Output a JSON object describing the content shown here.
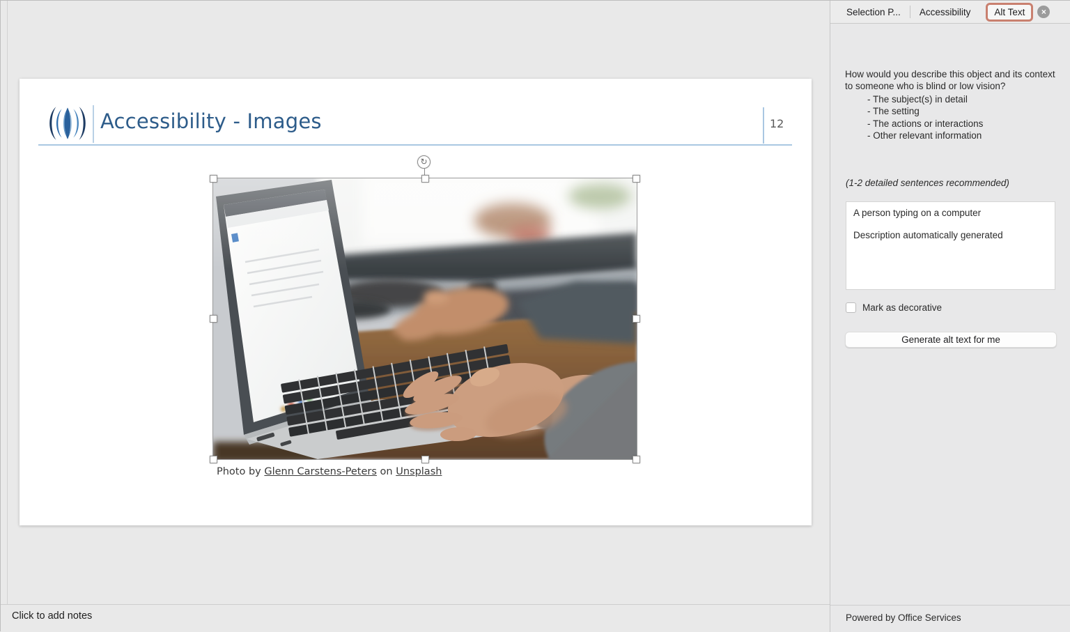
{
  "slide": {
    "title": "Accessibility - Images",
    "page_number": "12",
    "caption": {
      "prefix": "Photo by ",
      "author_link": "Glenn Carstens-Peters",
      "middle": " on ",
      "source_link": "Unsplash"
    }
  },
  "notes": {
    "placeholder": "Click to add notes"
  },
  "panel": {
    "tabs": [
      {
        "label": "Selection P..."
      },
      {
        "label": "Accessibility"
      },
      {
        "label": "Alt Text",
        "active": true
      }
    ],
    "question": "How would you describe this object and its context to someone who is blind or low vision?",
    "bullets": [
      "- The subject(s) in detail",
      "- The setting",
      "- The actions or interactions",
      "- Other relevant information"
    ],
    "hint": "(1-2 detailed sentences recommended)",
    "alt_text_value": "A person typing on a computer\n\nDescription automatically generated",
    "decorative_label": "Mark as decorative",
    "generate_button_label": "Generate alt text for me",
    "footer": "Powered by Office Services"
  },
  "icons": {
    "close": "×",
    "rotate": "↻"
  },
  "colors": {
    "active_tab_border": "#c9806f",
    "title_blue": "#2d5c8a",
    "rule_blue": "#a9c7e2",
    "panel_bg": "#e8e8e9"
  }
}
